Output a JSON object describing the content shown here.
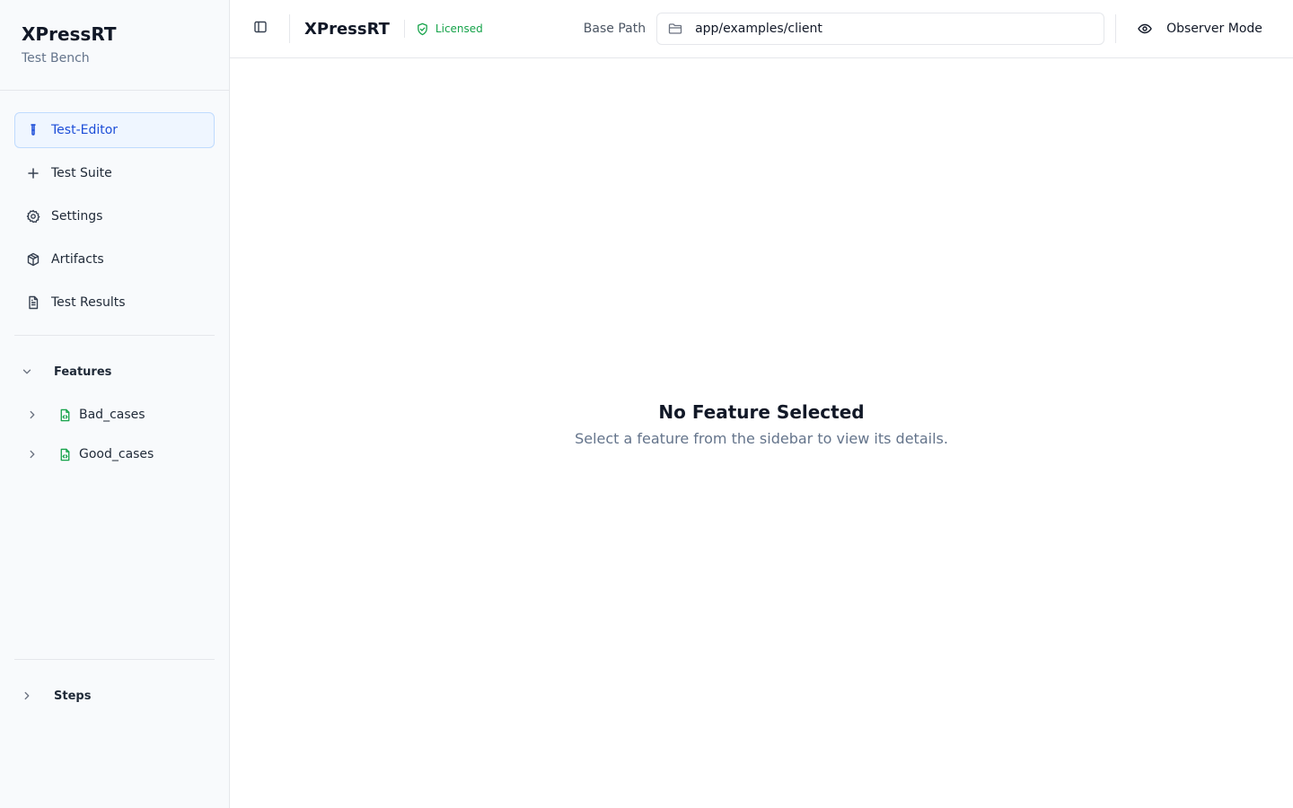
{
  "brand": {
    "title": "XPressRT",
    "subtitle": "Test Bench"
  },
  "nav": [
    {
      "label": "Test-Editor",
      "icon": "test-tube-icon",
      "active": true
    },
    {
      "label": "Test Suite",
      "icon": "plus-icon"
    },
    {
      "label": "Settings",
      "icon": "gear-icon"
    },
    {
      "label": "Artifacts",
      "icon": "package-icon"
    },
    {
      "label": "Test Results",
      "icon": "file-text-icon"
    }
  ],
  "features": {
    "heading": "Features",
    "items": [
      {
        "label": "Bad_cases",
        "icon": "file-code-icon"
      },
      {
        "label": "Good_cases",
        "icon": "file-code-icon"
      }
    ]
  },
  "steps": {
    "heading": "Steps"
  },
  "header": {
    "title": "XPressRT",
    "license_label": "Licensed",
    "base_path_label": "Base Path",
    "base_path_value": "app/examples/client",
    "observer_label": "Observer Mode"
  },
  "main": {
    "empty_title": "No Feature Selected",
    "empty_subtitle": "Select a feature from the sidebar to view its details."
  },
  "colors": {
    "accent": "#1d4ed8",
    "license": "#16a34a",
    "file_icon": "#16a34a"
  }
}
